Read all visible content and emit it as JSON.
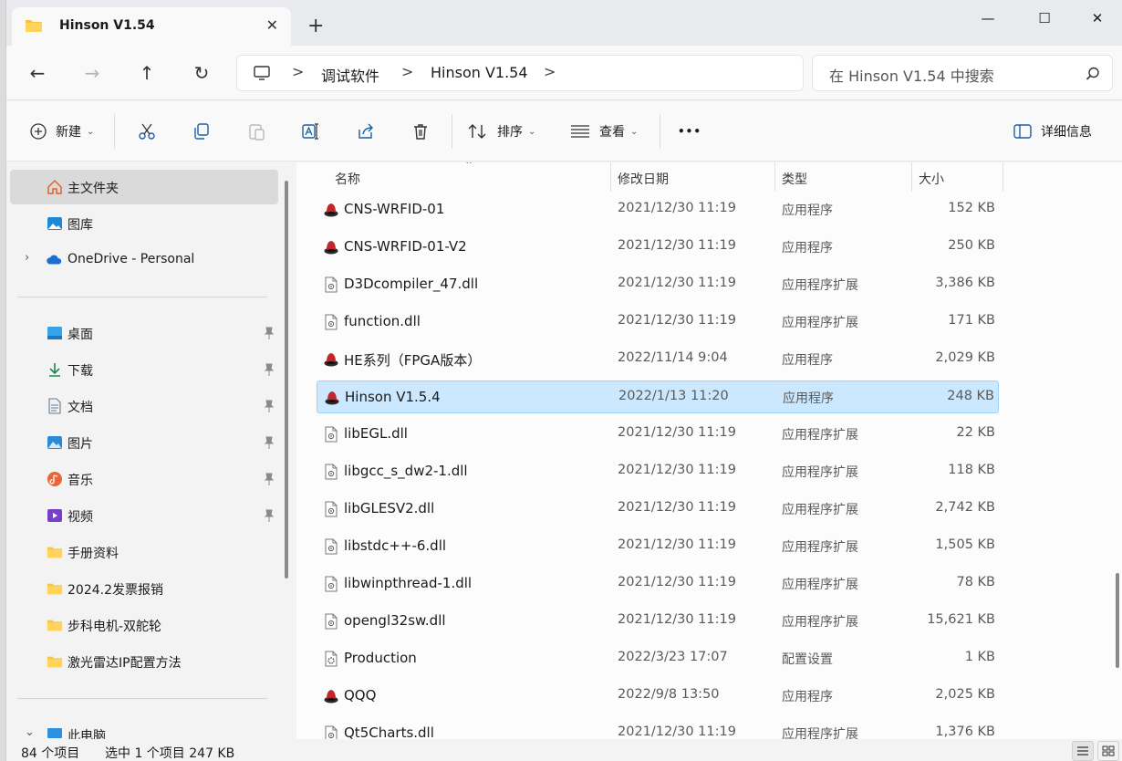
{
  "window": {
    "tab_title": "Hinson V1.54",
    "tab_close": "✕",
    "new_tab": "+",
    "minimize": "—",
    "maximize": "☐",
    "close": "✕"
  },
  "nav": {
    "back": "←",
    "forward": "→",
    "up": "↑",
    "refresh": "↻"
  },
  "address": {
    "separator": ">",
    "crumbs": [
      "调试软件",
      "Hinson V1.54"
    ]
  },
  "search": {
    "placeholder": "在 Hinson V1.54 中搜索"
  },
  "toolbar": {
    "new_label": "新建",
    "sort_label": "排序",
    "view_label": "查看",
    "more_label": "•••",
    "details_label": "详细信息"
  },
  "sidebar": {
    "items": [
      {
        "label": "主文件夹",
        "icon": "home-icon"
      },
      {
        "label": "图库",
        "icon": "gallery-icon"
      },
      {
        "label": "OneDrive - Personal",
        "icon": "cloud-icon"
      },
      {
        "label": "桌面",
        "icon": "desktop-icon"
      },
      {
        "label": "下载",
        "icon": "download-icon"
      },
      {
        "label": "文档",
        "icon": "document-icon"
      },
      {
        "label": "图片",
        "icon": "pictures-icon"
      },
      {
        "label": "音乐",
        "icon": "music-icon"
      },
      {
        "label": "视频",
        "icon": "video-icon"
      },
      {
        "label": "手册资料",
        "icon": "folder-icon"
      },
      {
        "label": "2024.2发票报销",
        "icon": "folder-icon"
      },
      {
        "label": "步科电机-双舵轮",
        "icon": "folder-icon"
      },
      {
        "label": "激光雷达IP配置方法",
        "icon": "folder-icon"
      },
      {
        "label": "此电脑",
        "icon": "pc-icon"
      }
    ]
  },
  "columns": {
    "name": "名称",
    "modified": "修改日期",
    "type": "类型",
    "size": "大小"
  },
  "files": [
    {
      "name": "CNS-WRFID-01",
      "date": "2021/12/30 11:19",
      "type": "应用程序",
      "size": "152 KB",
      "icon": "app-icon"
    },
    {
      "name": "CNS-WRFID-01-V2",
      "date": "2021/12/30 11:19",
      "type": "应用程序",
      "size": "250 KB",
      "icon": "app-icon"
    },
    {
      "name": "D3Dcompiler_47.dll",
      "date": "2021/12/30 11:19",
      "type": "应用程序扩展",
      "size": "3,386 KB",
      "icon": "dll-icon"
    },
    {
      "name": "function.dll",
      "date": "2021/12/30 11:19",
      "type": "应用程序扩展",
      "size": "171 KB",
      "icon": "dll-icon"
    },
    {
      "name": "HE系列（FPGA版本）",
      "date": "2022/11/14 9:04",
      "type": "应用程序",
      "size": "2,029 KB",
      "icon": "app-icon"
    },
    {
      "name": "Hinson  V1.5.4",
      "date": "2022/1/13 11:20",
      "type": "应用程序",
      "size": "248 KB",
      "icon": "app-icon"
    },
    {
      "name": "libEGL.dll",
      "date": "2021/12/30 11:19",
      "type": "应用程序扩展",
      "size": "22 KB",
      "icon": "dll-icon"
    },
    {
      "name": "libgcc_s_dw2-1.dll",
      "date": "2021/12/30 11:19",
      "type": "应用程序扩展",
      "size": "118 KB",
      "icon": "dll-icon"
    },
    {
      "name": "libGLESV2.dll",
      "date": "2021/12/30 11:19",
      "type": "应用程序扩展",
      "size": "2,742 KB",
      "icon": "dll-icon"
    },
    {
      "name": "libstdc++-6.dll",
      "date": "2021/12/30 11:19",
      "type": "应用程序扩展",
      "size": "1,505 KB",
      "icon": "dll-icon"
    },
    {
      "name": "libwinpthread-1.dll",
      "date": "2021/12/30 11:19",
      "type": "应用程序扩展",
      "size": "78 KB",
      "icon": "dll-icon"
    },
    {
      "name": "opengl32sw.dll",
      "date": "2021/12/30 11:19",
      "type": "应用程序扩展",
      "size": "15,621 KB",
      "icon": "dll-icon"
    },
    {
      "name": "Production",
      "date": "2022/3/23 17:07",
      "type": "配置设置",
      "size": "1 KB",
      "icon": "config-icon"
    },
    {
      "name": "QQQ",
      "date": "2022/9/8 13:50",
      "type": "应用程序",
      "size": "2,025 KB",
      "icon": "app-icon"
    },
    {
      "name": "Qt5Charts.dll",
      "date": "2021/12/30 11:19",
      "type": "应用程序扩展",
      "size": "1,376 KB",
      "icon": "dll-icon"
    }
  ],
  "selected_file_index": 5,
  "status": {
    "item_count": "84 个项目",
    "selection": "选中 1 个项目  247 KB"
  },
  "colors": {
    "selection_bg": "#cce8ff",
    "selection_border": "#99d1ff",
    "folder": "#f4c542",
    "accent": "#0067c0"
  }
}
